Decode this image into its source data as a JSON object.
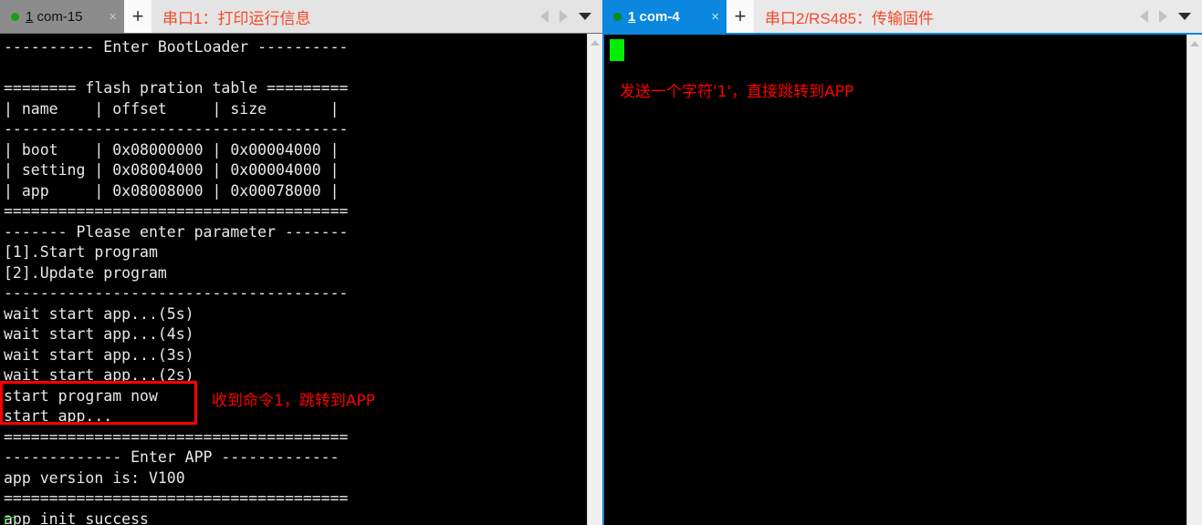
{
  "left_panel": {
    "tab": {
      "number": "1",
      "name": " com-15",
      "close_label": "×",
      "status_dot": "connected-green"
    },
    "add_tab_label": "+",
    "title": "串口1：打印运行信息",
    "nav": {
      "prev_icon": "chevron-left-icon",
      "next_icon": "chevron-right-icon",
      "dropdown_icon": "chevron-down-icon"
    },
    "terminal_text": "---------- Enter BootLoader ----------\n\n======== flash pration table =========\n| name    | offset     | size       |\n--------------------------------------\n| boot    | 0x08000000 | 0x00004000 |\n| setting | 0x08004000 | 0x00004000 |\n| app     | 0x08008000 | 0x00078000 |\n======================================\n------- Please enter parameter -------\n[1].Start program\n[2].Update program\n--------------------------------------\nwait start app...(5s)\nwait start app...(4s)\nwait start app...(3s)\nwait start app...(2s)\nstart program now\nstart app...\n======================================\n------------- Enter APP -------------\napp version is: V100\n======================================\napp init success",
    "annotation": "收到命令1，跳转到APP",
    "highlight_color": "#ff0000"
  },
  "right_panel": {
    "tab": {
      "number": "1",
      "name": " com-4",
      "close_label": "×",
      "status_dot": "connected-green"
    },
    "add_tab_label": "+",
    "title": "串口2/RS485：传输固件",
    "nav": {
      "prev_icon": "chevron-left-icon",
      "next_icon": "chevron-right-icon",
      "dropdown_icon": "chevron-down-icon"
    },
    "terminal_text": "",
    "annotation": "发送一个字符'1'，直接跳转到APP",
    "accent_color": "#0b87e0"
  }
}
